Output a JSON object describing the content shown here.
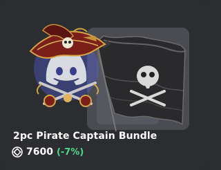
{
  "item": {
    "name": "2pc Pirate Captain Bundle",
    "price": "7600",
    "discount": "(-7%)",
    "currency_icon": "orb-icon",
    "colors": {
      "background": "#2b2d31",
      "discount": "#4ed98a",
      "accent_blurple": "#5865f2"
    }
  }
}
